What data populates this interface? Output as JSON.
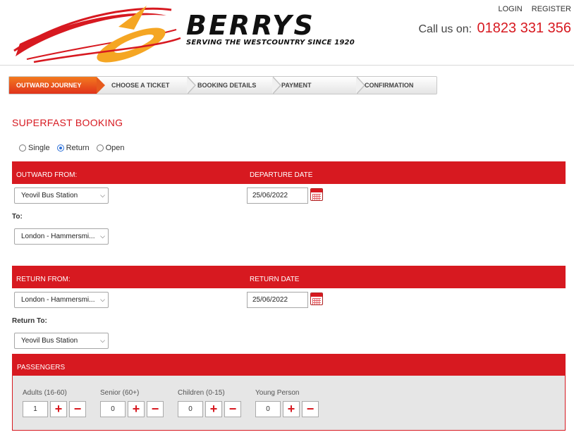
{
  "header": {
    "brand": "BERRYS",
    "tagline": "SERVING THE WESTCOUNTRY SINCE 1920",
    "login": "LOGIN",
    "register": "REGISTER",
    "call_label": "Call us on:",
    "phone": "01823 331 356"
  },
  "steps": [
    "OUTWARD JOURNEY",
    "CHOOSE A TICKET",
    "BOOKING DETAILS",
    "PAYMENT",
    "CONFIRMATION"
  ],
  "active_step": "OUTWARD JOURNEY",
  "page_title": "SUPERFAST BOOKING",
  "journey_type": {
    "options": [
      "Single",
      "Return",
      "Open"
    ],
    "selected": "Return"
  },
  "outward": {
    "from_header": "OUTWARD FROM:",
    "date_header": "DEPARTURE DATE",
    "from_value": "Yeovil Bus Station",
    "date_value": "25/06/2022",
    "to_label": "To:",
    "to_value": "London - Hammersmi..."
  },
  "return": {
    "from_header": "RETURN FROM:",
    "date_header": "RETURN DATE",
    "from_value": "London - Hammersmi...",
    "date_value": "25/06/2022",
    "to_label": "Return To:",
    "to_value": "Yeovil Bus Station"
  },
  "passengers": {
    "header": "PASSENGERS",
    "groups": [
      {
        "label": "Adults (16-60)",
        "value": "1"
      },
      {
        "label": "Senior (60+)",
        "value": "0"
      },
      {
        "label": "Children (0-15)",
        "value": "0"
      },
      {
        "label": "Young Person",
        "value": "0"
      }
    ],
    "plus": "+",
    "minus": "−"
  },
  "icons": {
    "select_arrow": "chevron-down-icon",
    "calendar": "calendar-icon"
  },
  "colors": {
    "brand_red": "#d71920",
    "active_step": "#f37a1f",
    "logo_orange": "#f5a623"
  }
}
